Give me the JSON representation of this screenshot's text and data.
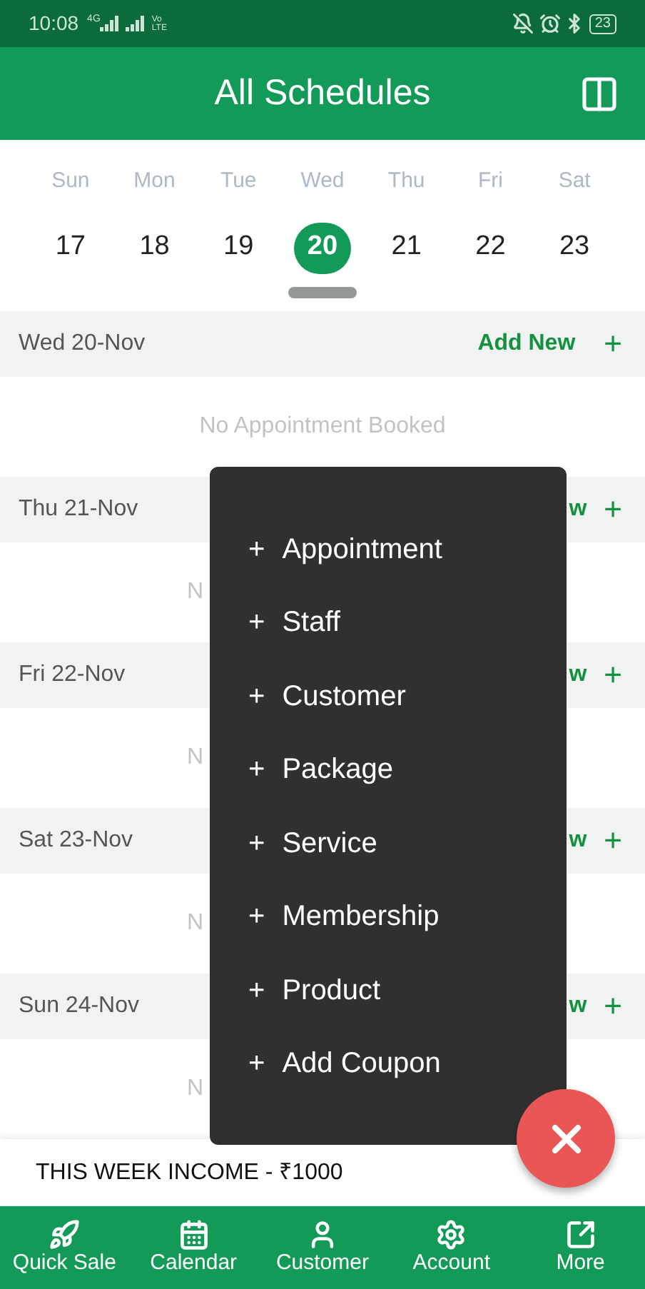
{
  "status_bar": {
    "time": "10:08",
    "network": "4G",
    "volte_top": "Vo",
    "volte_bottom": "LTE",
    "battery": "23"
  },
  "header": {
    "title": "All Schedules"
  },
  "week": [
    {
      "day": "Sun",
      "date": "17",
      "selected": false
    },
    {
      "day": "Mon",
      "date": "18",
      "selected": false
    },
    {
      "day": "Tue",
      "date": "19",
      "selected": false
    },
    {
      "day": "Wed",
      "date": "20",
      "selected": true
    },
    {
      "day": "Thu",
      "date": "21",
      "selected": false
    },
    {
      "day": "Fri",
      "date": "22",
      "selected": false
    },
    {
      "day": "Sat",
      "date": "23",
      "selected": false
    }
  ],
  "days": [
    {
      "label": "Wed 20-Nov",
      "action": "Add New",
      "plus": "+",
      "message": "No Appointment Booked",
      "covered": false
    },
    {
      "label": "Thu 21-Nov",
      "action": "w",
      "plus": "+",
      "message": "N",
      "covered": true
    },
    {
      "label": "Fri 22-Nov",
      "action": "w",
      "plus": "+",
      "message": "N",
      "covered": true
    },
    {
      "label": "Sat 23-Nov",
      "action": "w",
      "plus": "+",
      "message": "N",
      "covered": true
    },
    {
      "label": "Sun 24-Nov",
      "action": "w",
      "plus": "+",
      "message": "N",
      "covered": true
    }
  ],
  "income": "THIS WEEK INCOME - ₹1000",
  "menu": [
    {
      "plus": "+",
      "label": "Appointment"
    },
    {
      "plus": "+",
      "label": "Staff"
    },
    {
      "plus": "+",
      "label": "Customer"
    },
    {
      "plus": "+",
      "label": "Package"
    },
    {
      "plus": "+",
      "label": "Service"
    },
    {
      "plus": "+",
      "label": "Membership"
    },
    {
      "plus": "+",
      "label": "Product"
    },
    {
      "plus": "+",
      "label": "Add Coupon"
    }
  ],
  "nav": [
    {
      "kind": "rocket",
      "label": "Quick Sale"
    },
    {
      "kind": "calendar",
      "label": "Calendar"
    },
    {
      "kind": "user",
      "label": "Customer"
    },
    {
      "kind": "gear",
      "label": "Account"
    },
    {
      "kind": "external",
      "label": "More"
    }
  ]
}
